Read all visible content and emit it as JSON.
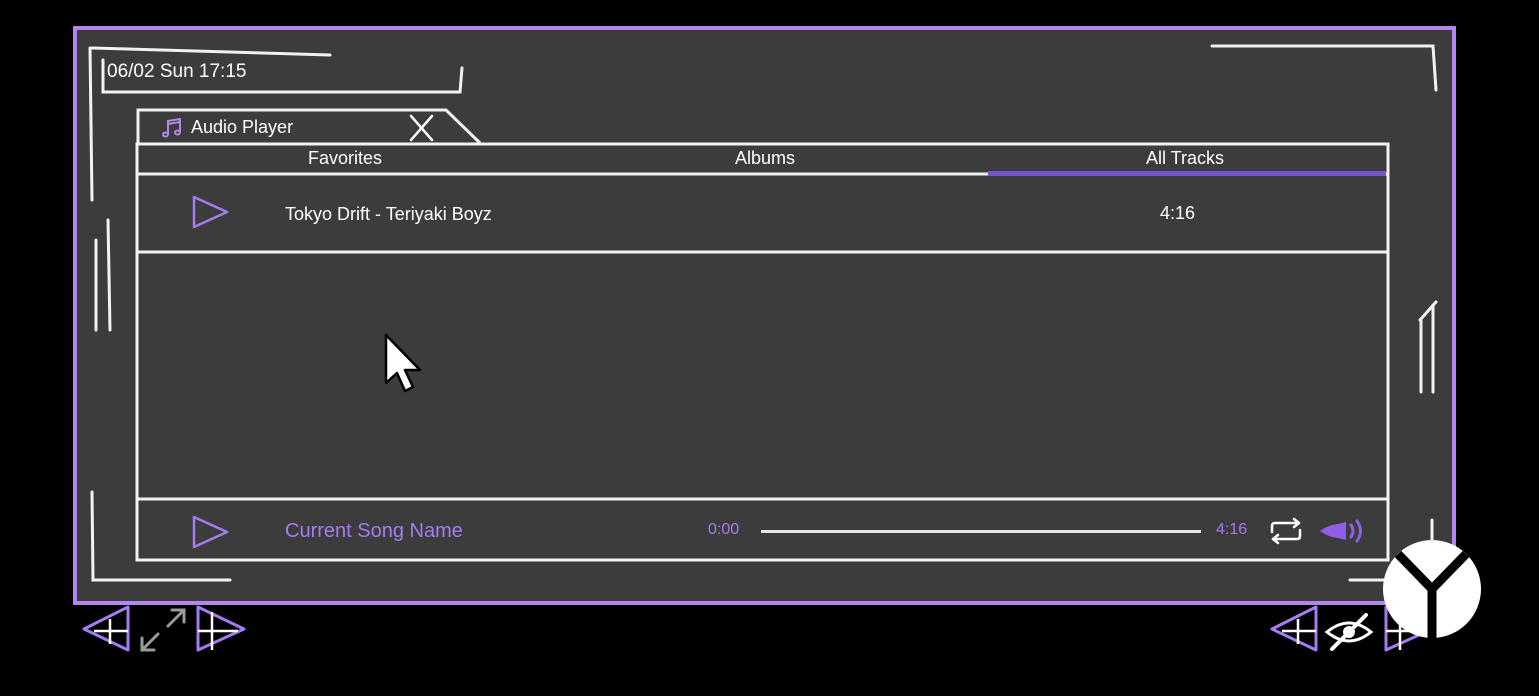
{
  "header": {
    "datetime": "06/02 Sun 17:15"
  },
  "window_tab": {
    "label": "Audio Player",
    "icon": "music-note-icon",
    "close_icon": "close-icon"
  },
  "tabs": [
    {
      "label": "Favorites",
      "active": false
    },
    {
      "label": "Albums",
      "active": false
    },
    {
      "label": "All Tracks",
      "active": true
    }
  ],
  "tracks": [
    {
      "title": "Tokyo Drift - Teriyaki Boyz",
      "duration": "4:16",
      "icon": "play-icon"
    }
  ],
  "player": {
    "current_song": "Current Song Name",
    "time_start": "0:00",
    "time_end": "4:16",
    "progress": 0,
    "repeat_icon": "repeat-icon",
    "volume_icon": "volume-icon"
  },
  "bottom_controls": {
    "left": [
      "prev-arrow-icon",
      "expand-icon",
      "next-arrow-icon"
    ],
    "right": [
      "prev-arrow-icon",
      "hide-eye-icon",
      "next-arrow-icon",
      "logo-icon"
    ]
  },
  "colors": {
    "accent": "#b187ee",
    "accent_text": "#a37cf0",
    "background": "#3c3c3c",
    "tab_underline": "#7a55c9"
  }
}
